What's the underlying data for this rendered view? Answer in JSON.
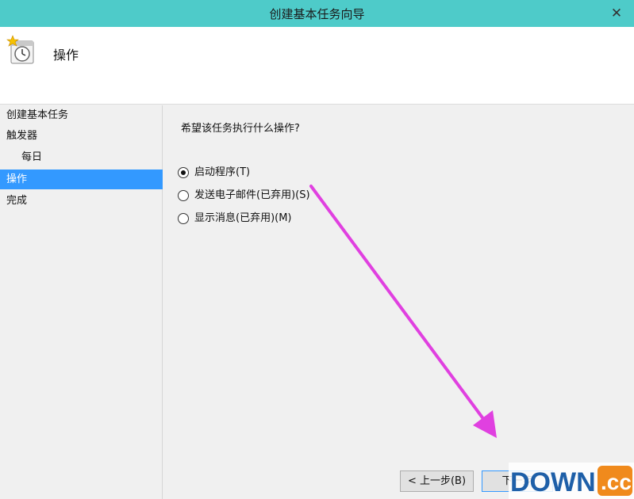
{
  "window": {
    "title": "创建基本任务向导",
    "close_glyph": "✕"
  },
  "header": {
    "heading": "操作"
  },
  "sidebar": {
    "items": [
      {
        "label": "创建基本任务"
      },
      {
        "label": "触发器"
      },
      {
        "label": "每日"
      },
      {
        "label": "操作"
      },
      {
        "label": "完成"
      }
    ],
    "active_index": 3
  },
  "main": {
    "question": "希望该任务执行什么操作?",
    "options": [
      {
        "label": "启动程序(T)",
        "selected": true
      },
      {
        "label": "发送电子邮件(已弃用)(S)",
        "selected": false
      },
      {
        "label": "显示消息(已弃用)(M)",
        "selected": false
      }
    ]
  },
  "footer": {
    "back_label": "< 上一步(B)",
    "next_label": "下一步"
  },
  "watermark": {
    "text": "DOWN.cc"
  },
  "colors": {
    "titlebar": "#4ecbc9",
    "selection": "#3399ff",
    "annotation_arrow": "#e040e0",
    "watermark_orange": "#f08a1c",
    "watermark_blue": "#1e5fa8"
  }
}
